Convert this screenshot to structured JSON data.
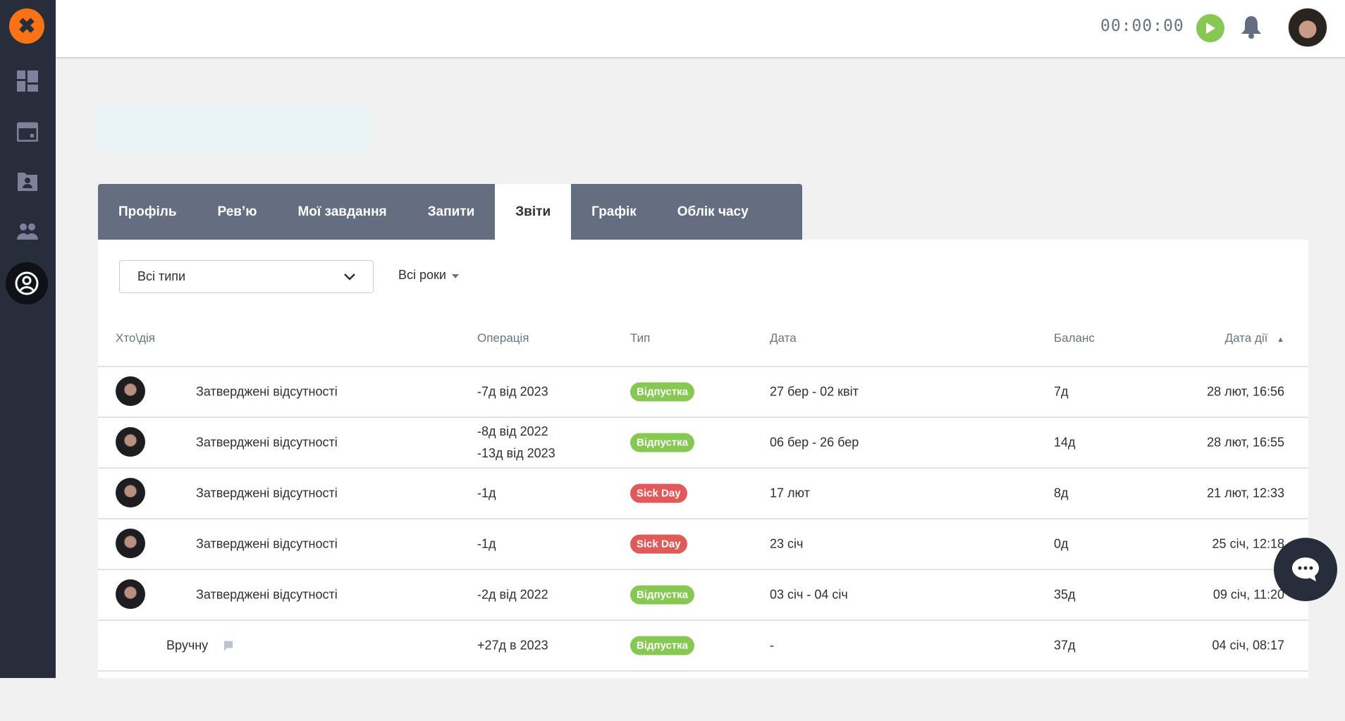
{
  "header": {
    "timer": "00:00:00"
  },
  "tabs": [
    "Профіль",
    "Рев’ю",
    "Мої завдання",
    "Запити",
    "Звіти",
    "Графік",
    "Облік часу"
  ],
  "active_tab": "Звіти",
  "filters": {
    "type_select": "Всі типи",
    "years": "Всі роки"
  },
  "table": {
    "headers": {
      "who": "Хто\\дія",
      "operation": "Операція",
      "type": "Тип",
      "date": "Дата",
      "balance": "Баланс",
      "action_date": "Дата дії"
    },
    "rows": [
      {
        "who": "Затверджені відсутності",
        "op1": "-7д від 2023",
        "op2": "",
        "type": "Відпустка",
        "type_color": "#86c852",
        "date": "27 бер - 02 квіт",
        "balance": "7д",
        "action_date": "28 лют, 16:56"
      },
      {
        "who": "Затверджені відсутності",
        "op1": "-8д від 2022",
        "op2": "-13д від 2023",
        "type": "Відпустка",
        "type_color": "#86c852",
        "date": "06 бер - 26 бер",
        "balance": "14д",
        "action_date": "28 лют, 16:55"
      },
      {
        "who": "Затверджені відсутності",
        "op1": "-1д",
        "op2": "",
        "type": "Sick Day",
        "type_color": "#e05a5a",
        "date": "17 лют",
        "balance": "8д",
        "action_date": "21 лют, 12:33"
      },
      {
        "who": "Затверджені відсутності",
        "op1": "-1д",
        "op2": "",
        "type": "Sick Day",
        "type_color": "#e05a5a",
        "date": "23 січ",
        "balance": "0д",
        "action_date": "25 січ, 12:18"
      },
      {
        "who": "Затверджені відсутності",
        "op1": "-2д від 2022",
        "op2": "",
        "type": "Відпустка",
        "type_color": "#86c852",
        "date": "03 січ - 04 січ",
        "balance": "35д",
        "action_date": "09 січ, 11:20"
      },
      {
        "who": "Вручну",
        "op1": "+27д в 2023",
        "op2": "",
        "type": "Відпустка",
        "type_color": "#86c852",
        "date": "-",
        "balance": "37д",
        "action_date": "04 січ, 08:17",
        "manual": true
      }
    ]
  }
}
